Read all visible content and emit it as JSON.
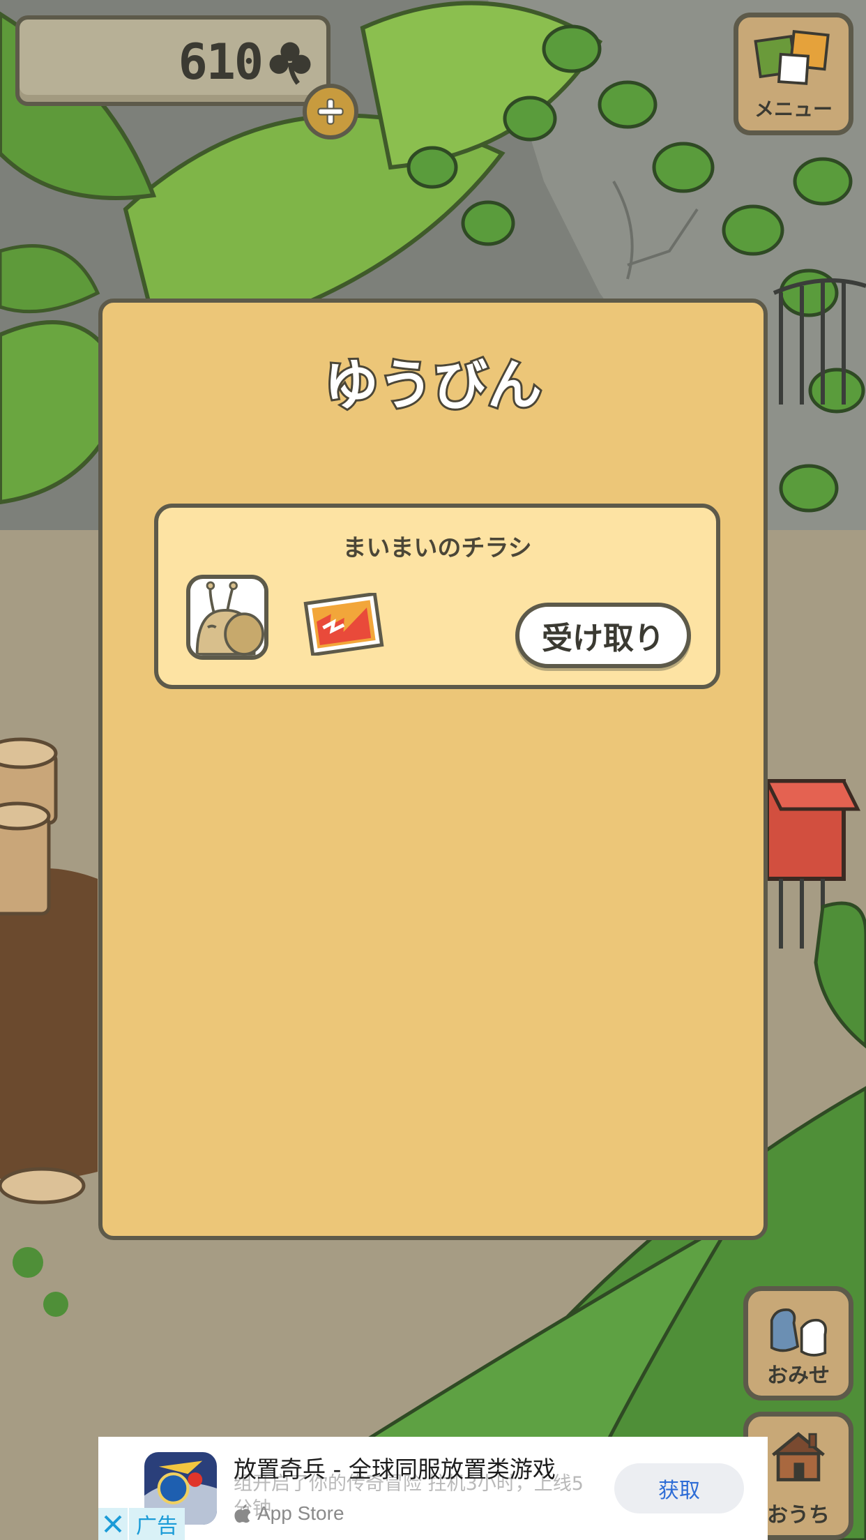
{
  "hud": {
    "clover_count": "610",
    "clover_icon": "clover-icon",
    "add_icon": "plus-icon",
    "menu_label": "メニュー"
  },
  "mail_dialog": {
    "title": "ゆうびん",
    "items": [
      {
        "sender": "まいまいのチラシ",
        "avatar_icon": "snail-avatar-icon",
        "attachment_icon": "flyer-icon",
        "action_label": "受け取り"
      }
    ]
  },
  "side_buttons": {
    "shop_label": "おみせ",
    "home_label": "おうち"
  },
  "ad": {
    "title": "放置奇兵 - 全球同服放置类游戏",
    "description": "组开启了你的传奇冒险 拄机3小时，上线5分钟",
    "store": "App Store",
    "get_label": "获取",
    "tag": "广告"
  },
  "colors": {
    "dialog_bg": "#ecc678",
    "card_bg": "#fde3a3",
    "outline": "#5d5a4a",
    "link_blue": "#2d6cd6",
    "ad_tag": "#1a9bd7"
  }
}
